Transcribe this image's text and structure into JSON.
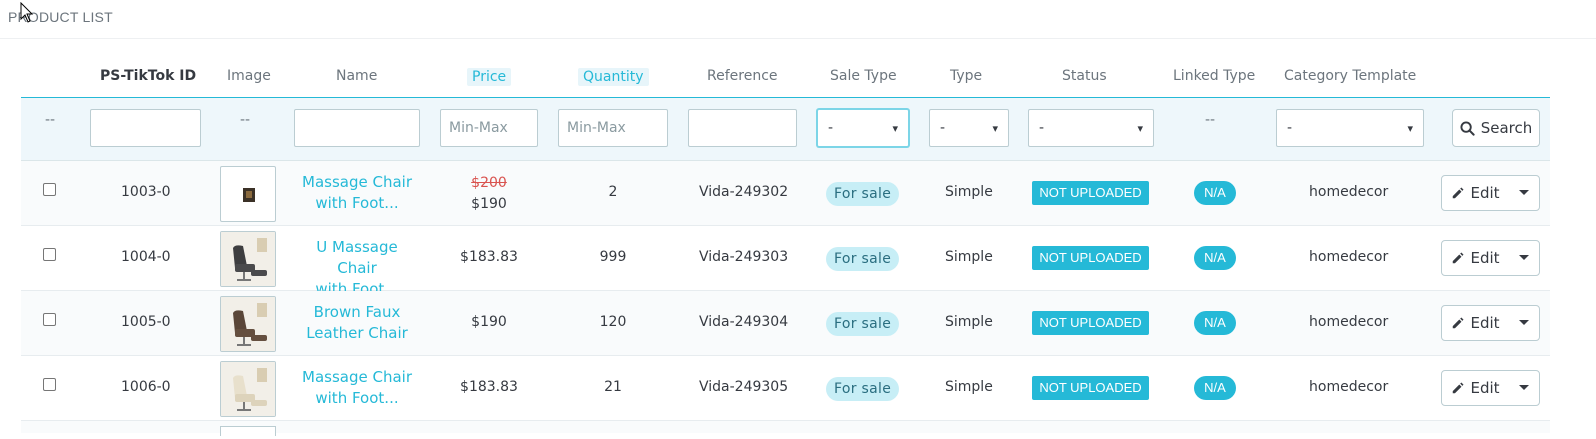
{
  "panel": {
    "title": "PRODUCT LIST"
  },
  "columns": {
    "id": "PS-TikTok ID",
    "image": "Image",
    "name": "Name",
    "price": "Price",
    "quantity": "Quantity",
    "reference": "Reference",
    "sale_type": "Sale Type",
    "type": "Type",
    "status": "Status",
    "linked_type": "Linked Type",
    "category_template": "Category Template"
  },
  "filters": {
    "dash": "--",
    "price_placeholder": "Min-Max",
    "quantity_placeholder": "Min-Max",
    "sale_type_value": "-",
    "type_value": "-",
    "status_value": "-",
    "category_value": "-",
    "search_label": "Search"
  },
  "rows": [
    {
      "id": "1003-0",
      "name_line1": "Massage Chair",
      "name_line2": "with Foot...",
      "price_old": "$200",
      "price": "$190",
      "quantity": "2",
      "reference": "Vida-249302",
      "sale_type": "For sale",
      "type": "Simple",
      "status": "NOT UPLOADED",
      "linked_type": "N/A",
      "category": "homedecor",
      "edit_label": "Edit"
    },
    {
      "id": "1004-0",
      "name_line1": "U Massage Chair",
      "name_line2": "with Foot...",
      "price_old": "",
      "price": "$183.83",
      "quantity": "999",
      "reference": "Vida-249303",
      "sale_type": "For sale",
      "type": "Simple",
      "status": "NOT UPLOADED",
      "linked_type": "N/A",
      "category": "homedecor",
      "edit_label": "Edit"
    },
    {
      "id": "1005-0",
      "name_line1": "Brown Faux",
      "name_line2": "Leather Chair",
      "price_old": "",
      "price": "$190",
      "quantity": "120",
      "reference": "Vida-249304",
      "sale_type": "For sale",
      "type": "Simple",
      "status": "NOT UPLOADED",
      "linked_type": "N/A",
      "category": "homedecor",
      "edit_label": "Edit"
    },
    {
      "id": "1006-0",
      "name_line1": "Massage Chair",
      "name_line2": "with Foot...",
      "price_old": "",
      "price": "$183.83",
      "quantity": "21",
      "reference": "Vida-249305",
      "sale_type": "For sale",
      "type": "Simple",
      "status": "NOT UPLOADED",
      "linked_type": "N/A",
      "category": "homedecor",
      "edit_label": "Edit"
    }
  ],
  "colors": {
    "accent": "#25b9d7",
    "price_old": "#d9534f",
    "pill": "#c7eef6"
  }
}
